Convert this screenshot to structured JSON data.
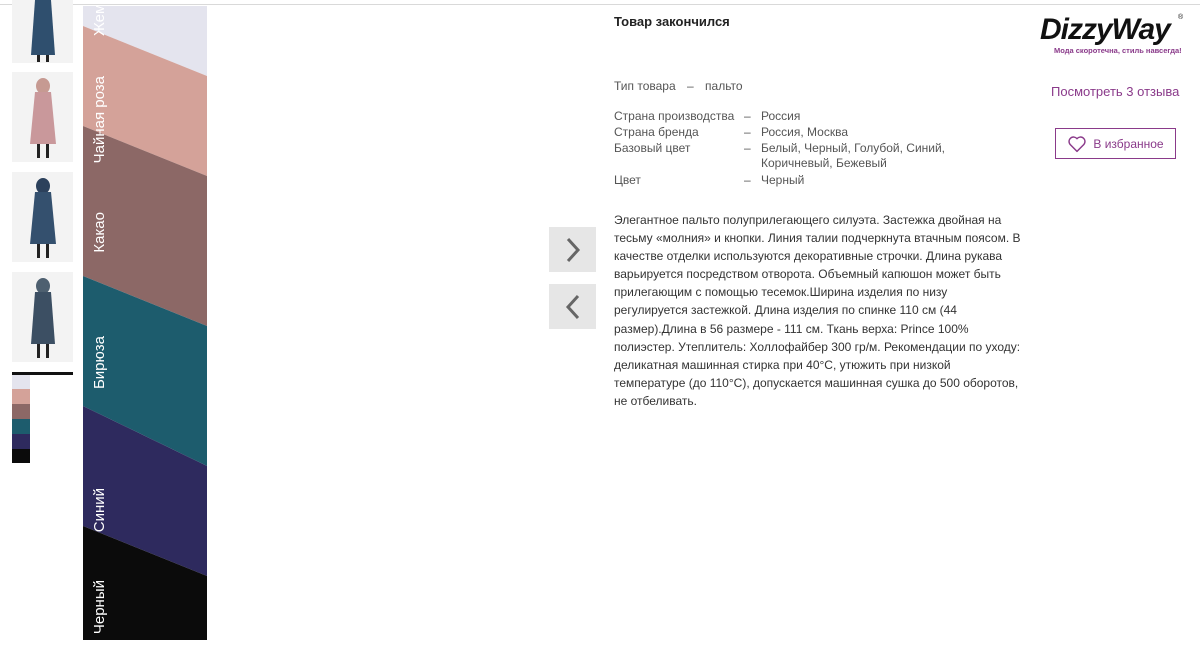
{
  "product": {
    "status": "Товар закончился",
    "type_label": "Тип товара",
    "type_value": "пальто",
    "dash": "–",
    "properties": [
      {
        "name": "Страна производства",
        "value": "Россия"
      },
      {
        "name": "Страна бренда",
        "value": "Россия, Москва"
      },
      {
        "name": "Базовый цвет",
        "value": "Белый, Черный, Голубой, Синий,",
        "value2": "Коричневый, Бежевый"
      },
      {
        "name": "Цвет",
        "value": "Черный"
      }
    ],
    "description": "Элегантное пальто полуприлегающего силуэта. Застежка двойная на тесьму «молния» и кнопки. Линия талии подчеркнута втачным поясом. В качестве отделки используются декоративные строчки. Длина рукава варьируется посредством отворота. Объемный капюшон может быть прилегающим с помощью тесемок.Ширина изделия по низу регулируется застежкой. Длина изделия по спинке 110 см (44 размер).Длина в 56 размере - 111 см. Ткань верха: Prince 100% полиэстер. Утеплитель: Холлофайбер 300 гр/м. Рекомендации по уходу: деликатная машинная стирка при 40°С, утюжить при низкой температуре (до 110°С), допускается машинная сушка до 500 оборотов, не отбеливать."
  },
  "swatches": {
    "labels": [
      "Жемчуг",
      "Чайная роза",
      "Какао",
      "Бирюза",
      "Синий",
      "Черный"
    ],
    "colors": [
      "#e4e4ee",
      "#d4a299",
      "#8c6866",
      "#1d5c6d",
      "#2e2a5e",
      "#0b0b0b"
    ]
  },
  "brand": {
    "logo_text": "DizzyWay",
    "tagline": "Мода скоротечна, стиль навсегда!",
    "accent": "#8a3a8a"
  },
  "actions": {
    "reviews": "Посмотреть 3 отзыва",
    "favorite": "В избранное"
  }
}
